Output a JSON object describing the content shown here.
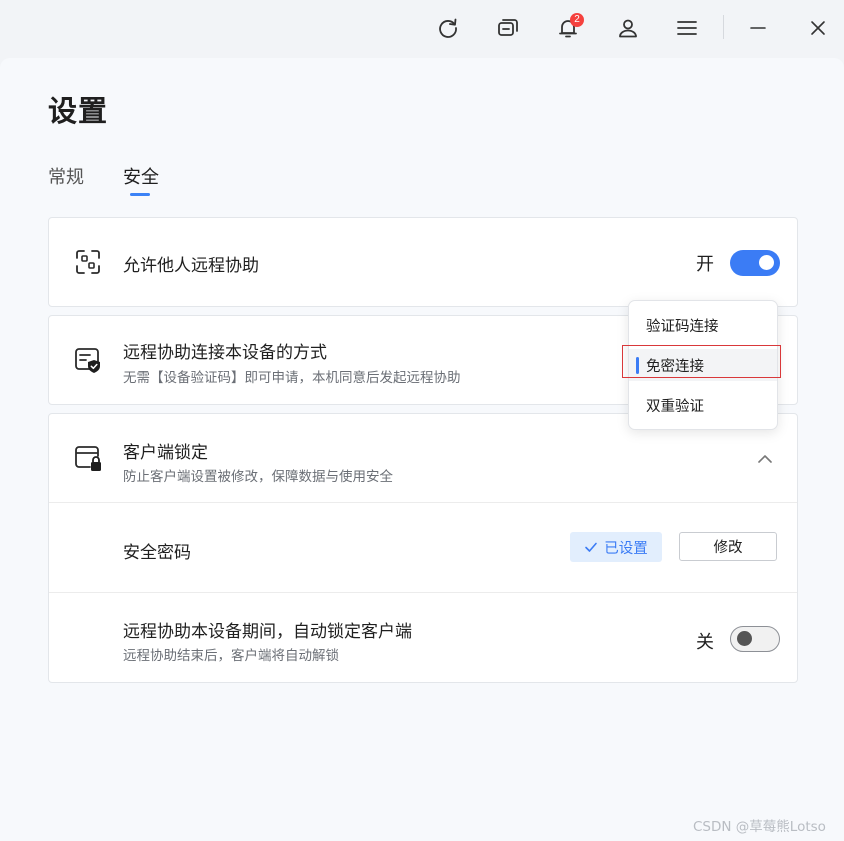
{
  "titlebar": {
    "icons": [
      "refresh-icon",
      "windows-icon",
      "bell-icon",
      "user-icon",
      "menu-icon",
      "minimize-icon",
      "close-icon"
    ],
    "notification_count": "2"
  },
  "page": {
    "title": "设置"
  },
  "tabs": [
    {
      "label": "常规",
      "active": false
    },
    {
      "label": "安全",
      "active": true
    }
  ],
  "allow_remote": {
    "title": "允许他人远程协助",
    "state_label": "开",
    "enabled": true
  },
  "connect_method": {
    "title": "远程协助连接本设备的方式",
    "subtitle": "无需【设备验证码】即可申请，本机同意后发起远程协助"
  },
  "dropdown": {
    "options": [
      "验证码连接",
      "免密连接",
      "双重验证"
    ],
    "selected": "免密连接"
  },
  "client_lock": {
    "title": "客户端锁定",
    "subtitle": "防止客户端设置被修改，保障数据与使用安全",
    "expanded": true
  },
  "security_password": {
    "title": "安全密码",
    "status": "已设置",
    "modify_label": "修改"
  },
  "auto_lock": {
    "title": "远程协助本设备期间，自动锁定客户端",
    "subtitle": "远程协助结束后，客户端将自动解锁",
    "state_label": "关",
    "enabled": false
  },
  "watermark": "CSDN @草莓熊Lotso",
  "colors": {
    "accent": "#3b7cf5",
    "badge": "#f5413e",
    "chip_bg": "#e2eefd",
    "highlight_border": "#d9383a"
  }
}
